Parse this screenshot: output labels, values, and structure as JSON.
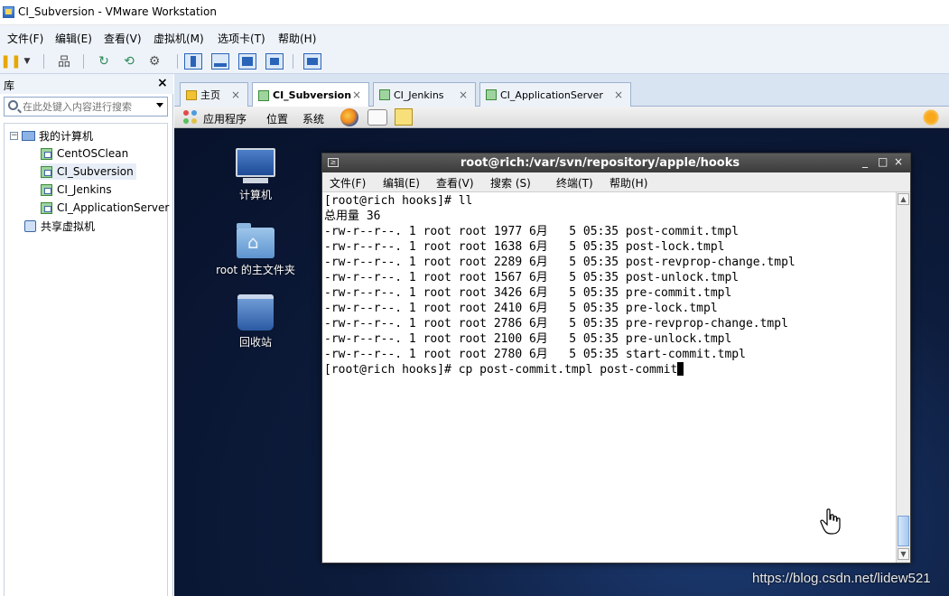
{
  "window": {
    "title": "CI_Subversion - VMware Workstation"
  },
  "menubar": {
    "items": [
      "文件(F)",
      "编辑(E)",
      "查看(V)",
      "虚拟机(M)",
      "选项卡(T)",
      "帮助(H)"
    ]
  },
  "library": {
    "title": "库",
    "close": "×",
    "search_placeholder": "在此处键入内容进行搜索",
    "tree": [
      {
        "label": "我的计算机",
        "expander": "−"
      },
      {
        "label": "CentOSClean"
      },
      {
        "label": "CI_Subversion"
      },
      {
        "label": "CI_Jenkins"
      },
      {
        "label": "CI_ApplicationServer"
      },
      {
        "label": "共享虚拟机"
      }
    ]
  },
  "tabs": [
    {
      "label": "主页",
      "close": "×"
    },
    {
      "label": "CI_Subversion",
      "close": "×"
    },
    {
      "label": "CI_Jenkins",
      "close": "×"
    },
    {
      "label": "CI_ApplicationServer",
      "close": "×"
    }
  ],
  "gnome_panel": {
    "applications": "应用程序",
    "places": "位置",
    "system": "系统"
  },
  "desktop": {
    "icons": [
      {
        "label": "计算机"
      },
      {
        "label": "root 的主文件夹"
      },
      {
        "label": "回收站"
      }
    ]
  },
  "terminal": {
    "title": "root@rich:/var/svn/repository/apple/hooks",
    "controls": {
      "minimize": "_",
      "maximize": "□",
      "close": "×"
    },
    "menu": [
      "文件(F)",
      "编辑(E)",
      "查看(V)",
      "搜索 (S)",
      "终端(T)",
      "帮助(H)"
    ],
    "lines": [
      "[root@rich hooks]# ll",
      "总用量 36",
      "-rw-r--r--. 1 root root 1977 6月   5 05:35 post-commit.tmpl",
      "-rw-r--r--. 1 root root 1638 6月   5 05:35 post-lock.tmpl",
      "-rw-r--r--. 1 root root 2289 6月   5 05:35 post-revprop-change.tmpl",
      "-rw-r--r--. 1 root root 1567 6月   5 05:35 post-unlock.tmpl",
      "-rw-r--r--. 1 root root 3426 6月   5 05:35 pre-commit.tmpl",
      "-rw-r--r--. 1 root root 2410 6月   5 05:35 pre-lock.tmpl",
      "-rw-r--r--. 1 root root 2786 6月   5 05:35 pre-revprop-change.tmpl",
      "-rw-r--r--. 1 root root 2100 6月   5 05:35 pre-unlock.tmpl",
      "-rw-r--r--. 1 root root 2780 6月   5 05:35 start-commit.tmpl",
      "[root@rich hooks]# cp post-commit.tmpl post-commit"
    ]
  },
  "watermark": "https://blog.csdn.net/lidew521",
  "colors": {
    "accent": "#2a64b8",
    "desktop": "#0d1c3c",
    "terminal_title": "#3b3b3b"
  }
}
